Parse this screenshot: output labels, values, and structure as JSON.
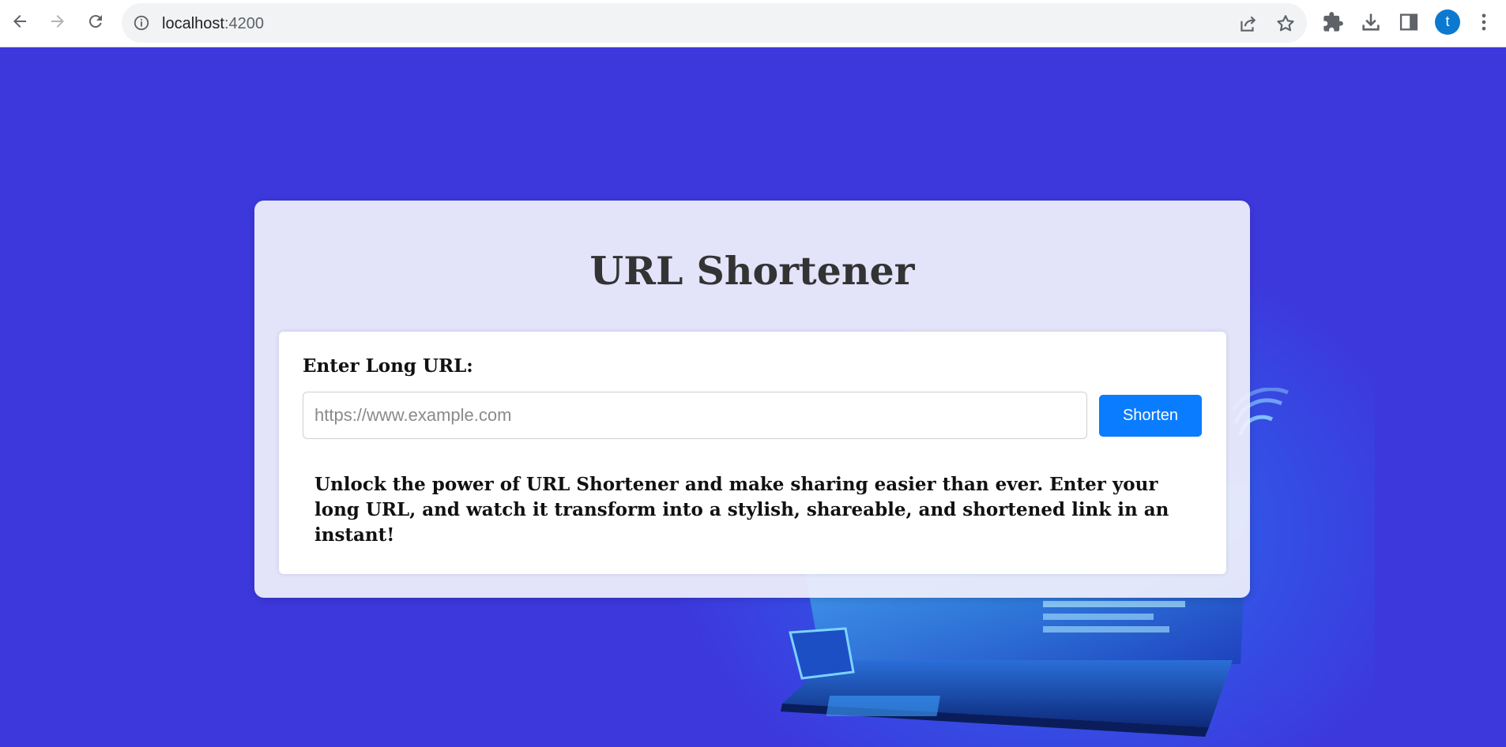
{
  "browser": {
    "url_host": "localhost",
    "url_port": ":4200",
    "profile_initial": "t",
    "icons": [
      "back-arrow-icon",
      "forward-arrow-icon",
      "reload-icon",
      "info-icon",
      "share-icon",
      "star-icon",
      "extensions-icon",
      "download-icon",
      "side-panel-icon",
      "menu-dots-icon"
    ]
  },
  "page": {
    "title": "URL Shortener",
    "form": {
      "label": "Enter Long URL:",
      "input_placeholder": "https://www.example.com",
      "input_value": "",
      "button_label": "Shorten"
    },
    "description": "Unlock the power of URL Shortener and make sharing easier than ever. Enter your long URL, and watch it transform into a stylish, shareable, and shortened link in an instant!"
  },
  "colors": {
    "background": "#3d38dc",
    "button": "#0a7cff",
    "title_text": "#333333"
  }
}
